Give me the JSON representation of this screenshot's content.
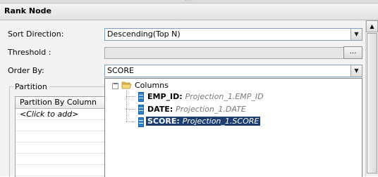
{
  "panel": {
    "title": "Rank Node"
  },
  "form": {
    "sort_direction": {
      "label": "Sort Direction:",
      "value": "Descending(Top N)"
    },
    "threshold": {
      "label": "Threshold :",
      "value": "",
      "button_label": "..."
    },
    "order_by": {
      "label": "Order By:",
      "value": "SCORE"
    }
  },
  "partition": {
    "legend": "Partition",
    "column_header": "Partition By Column",
    "add_row": "<Click to add>"
  },
  "order_by_dropdown": {
    "root": {
      "label": "Columns",
      "expander": "⊟"
    },
    "columns": [
      {
        "name": "EMP_ID",
        "source": "Projection_1.EMP_ID",
        "selected": false
      },
      {
        "name": "DATE",
        "source": "Projection_1.DATE",
        "selected": false
      },
      {
        "name": "SCORE",
        "source": "Projection_1.SCORE",
        "selected": true
      }
    ]
  },
  "icons": {
    "dropdown_arrow": "▼",
    "scroll_up": "▲",
    "folder": "folder-open-icon",
    "column": "column-icon"
  },
  "colors": {
    "selection": "#1c3f70",
    "column_icon": "#2a7fd4"
  }
}
